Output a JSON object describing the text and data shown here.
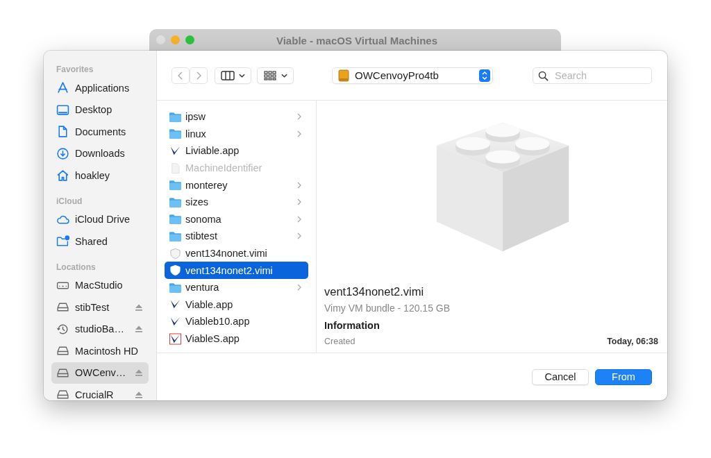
{
  "window": {
    "title": "Viable - macOS Virtual Machines"
  },
  "sidebar": [
    {
      "title": "Favorites",
      "items": [
        {
          "label": "Applications",
          "kind": "apps",
          "eject": false,
          "selected": false
        },
        {
          "label": "Desktop",
          "kind": "desktop",
          "eject": false,
          "selected": false
        },
        {
          "label": "Documents",
          "kind": "doc",
          "eject": false,
          "selected": false
        },
        {
          "label": "Downloads",
          "kind": "download",
          "eject": false,
          "selected": false
        },
        {
          "label": "hoakley",
          "kind": "home",
          "eject": false,
          "selected": false
        }
      ]
    },
    {
      "title": "iCloud",
      "items": [
        {
          "label": "iCloud Drive",
          "kind": "cloud",
          "eject": false,
          "selected": false
        },
        {
          "label": "Shared",
          "kind": "shared",
          "eject": false,
          "selected": false
        }
      ]
    },
    {
      "title": "Locations",
      "items": [
        {
          "label": "MacStudio",
          "kind": "computer",
          "eject": false,
          "selected": false
        },
        {
          "label": "stibTest",
          "kind": "drive",
          "eject": true,
          "selected": false
        },
        {
          "label": "studioBa…",
          "kind": "timemachine",
          "eject": true,
          "selected": false
        },
        {
          "label": "Macintosh HD",
          "kind": "drive",
          "eject": false,
          "selected": false
        },
        {
          "label": "OWCenv…",
          "kind": "drive",
          "eject": true,
          "selected": true
        },
        {
          "label": "CrucialR",
          "kind": "drive",
          "eject": true,
          "selected": false
        }
      ]
    }
  ],
  "toolbar": {
    "location": "OWCenvoyPro4tb",
    "search": {
      "placeholder": "Search"
    }
  },
  "files": [
    {
      "name": "ipsw",
      "kind": "folder",
      "selected": false,
      "disabled": false
    },
    {
      "name": "linux",
      "kind": "folder",
      "selected": false,
      "disabled": false
    },
    {
      "name": "Liviable.app",
      "kind": "app",
      "selected": false,
      "disabled": false
    },
    {
      "name": "MachineIdentifier",
      "kind": "doc",
      "selected": false,
      "disabled": true
    },
    {
      "name": "monterey",
      "kind": "folder",
      "selected": false,
      "disabled": false
    },
    {
      "name": "sizes",
      "kind": "folder",
      "selected": false,
      "disabled": false
    },
    {
      "name": "sonoma",
      "kind": "folder",
      "selected": false,
      "disabled": false
    },
    {
      "name": "stibtest",
      "kind": "folder",
      "selected": false,
      "disabled": false
    },
    {
      "name": "vent134nonet.vimi",
      "kind": "vimi",
      "selected": false,
      "disabled": false
    },
    {
      "name": "vent134nonet2.vimi",
      "kind": "vimi",
      "selected": true,
      "disabled": false
    },
    {
      "name": "ventura",
      "kind": "folder",
      "selected": false,
      "disabled": false
    },
    {
      "name": "Viable.app",
      "kind": "app",
      "selected": false,
      "disabled": false
    },
    {
      "name": "Viableb10.app",
      "kind": "app",
      "selected": false,
      "disabled": false
    },
    {
      "name": "ViableS.app",
      "kind": "appred",
      "selected": false,
      "disabled": false
    }
  ],
  "preview": {
    "name": "vent134nonet2.vimi",
    "subtitle": "Vimy VM bundle - 120.15 GB",
    "section": "Information",
    "rows": [
      {
        "label": "Created",
        "value": "Today, 06:38"
      }
    ]
  },
  "buttons": [
    {
      "label": "Cancel",
      "kind": "secondary"
    },
    {
      "label": "From",
      "kind": "primary"
    }
  ]
}
